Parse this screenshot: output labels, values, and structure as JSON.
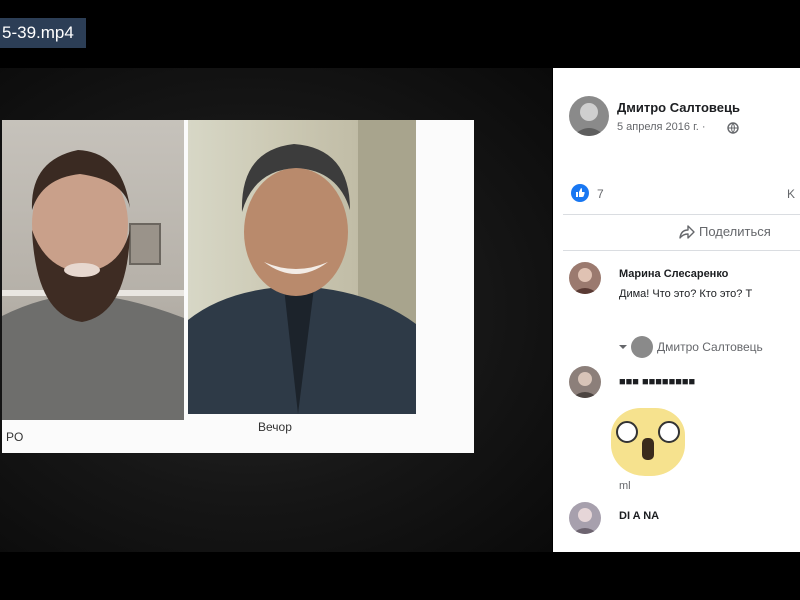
{
  "video_title": "5-39.mp4",
  "call": {
    "left_participant": "PO",
    "right_participant": "Вечор"
  },
  "post": {
    "author": "Дмитро Салтовець",
    "date": "5 апреля 2016 г. ·",
    "privacy_icon": "globe-icon",
    "reaction_icon": "like-icon",
    "reaction_count": "7",
    "side_count": "K",
    "share_label": "Поделиться"
  },
  "comments": [
    {
      "author": "Марина Слесаренко",
      "text": "Дима! Что это? Кто это? Т"
    },
    {
      "author": "■■■ ■■■■■■■■",
      "text": ""
    },
    {
      "author": "DI A NA",
      "text": ""
    }
  ],
  "reply": {
    "author": "Дмитро Салтовець"
  },
  "sticker_footer": "ml"
}
